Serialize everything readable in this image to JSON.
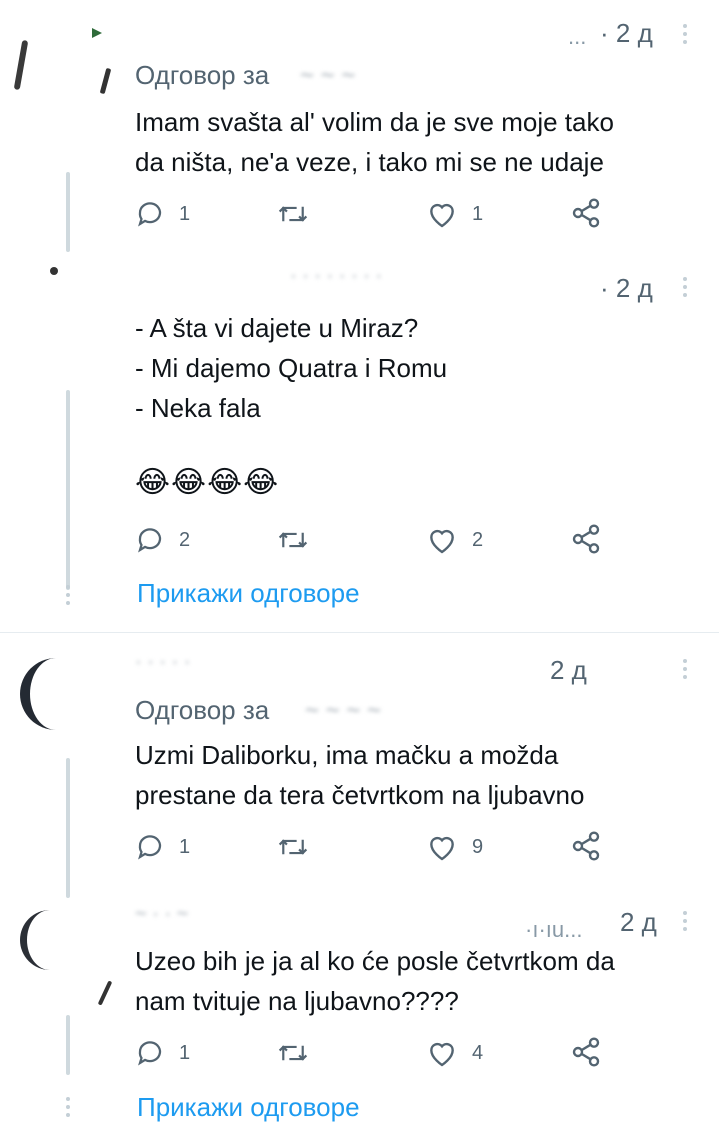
{
  "colors": {
    "accent": "#1d9bf0",
    "muted": "#536471",
    "text": "#0f1419",
    "line": "#cfd9de"
  },
  "tweets": [
    {
      "time": "· 2 д",
      "reply_to_label": "Одговор за",
      "text": "Imam svašta al' volim da je sve moje tako\nda ništa, ne'a veze, i tako mi se ne udaje",
      "replies": "1",
      "retweets": "",
      "likes": "1"
    },
    {
      "time": "· 2 д",
      "text": "- A šta vi dajete u Miraz?\n- Mi dajemo Quatra i Romu\n- Neka fala",
      "emoji": "😂😂😂😂",
      "replies": "2",
      "retweets": "",
      "likes": "2",
      "show_replies": "Прикажи одговоре"
    },
    {
      "time": "2 д",
      "reply_to_label": "Одговор за",
      "text": "Uzmi Daliborku, ima mačku a možda\nprestane da tera četvrtkom na ljubavno",
      "replies": "1",
      "retweets": "",
      "likes": "9"
    },
    {
      "time": "2 д",
      "text": "Uzeo bih je ja al ko će posle četvrtkom da\nnam tvituje na ljubavno????",
      "replies": "1",
      "retweets": "",
      "likes": "4",
      "show_replies": "Прикажи одговоре"
    }
  ],
  "icons": [
    "reply-icon",
    "retweet-icon",
    "like-icon",
    "share-icon",
    "more-icon"
  ]
}
